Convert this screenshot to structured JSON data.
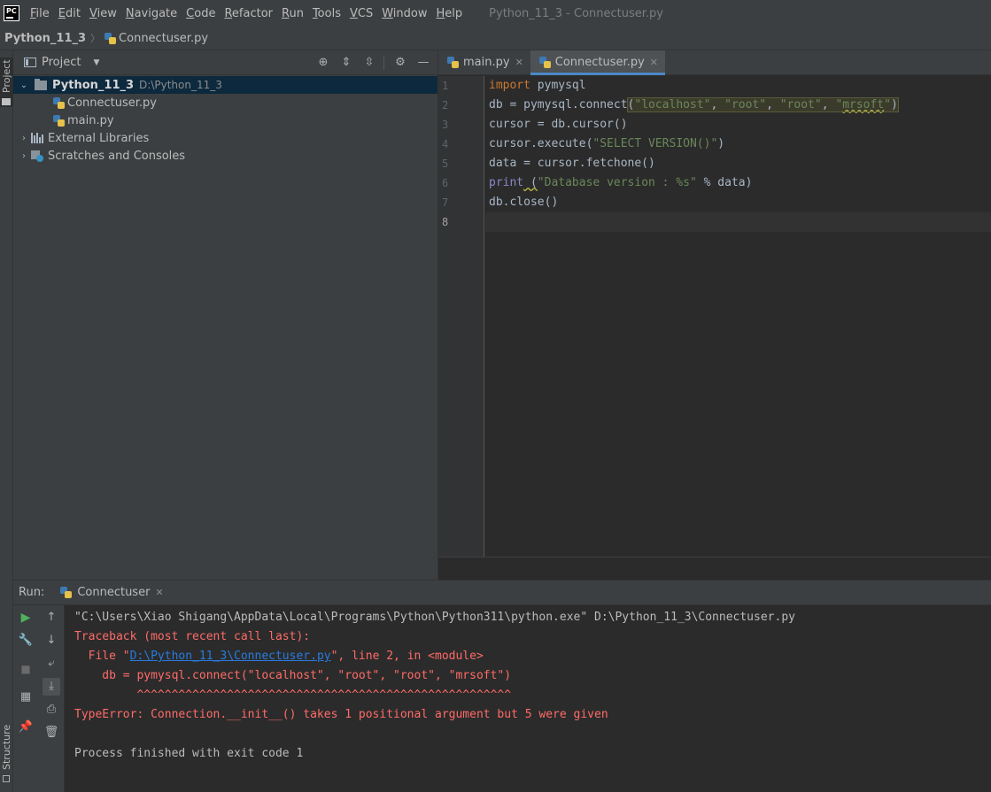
{
  "menu": {
    "logo": "PC",
    "items": [
      {
        "first": "F",
        "rest": "ile"
      },
      {
        "first": "E",
        "rest": "dit"
      },
      {
        "first": "V",
        "rest": "iew"
      },
      {
        "first": "N",
        "rest": "avigate"
      },
      {
        "first": "C",
        "rest": "ode"
      },
      {
        "first": "R",
        "rest": "efactor"
      },
      {
        "first": "R",
        "rest": "un"
      },
      {
        "first": "T",
        "rest": "ools"
      },
      {
        "first": "V",
        "rest": "CS"
      },
      {
        "first": "W",
        "rest": "indow"
      },
      {
        "first": "H",
        "rest": "elp"
      }
    ],
    "window_title": "Python_11_3 - Connectuser.py"
  },
  "navbar": {
    "project": "Python_11_3",
    "separator": "〉",
    "file": "Connectuser.py"
  },
  "side_strip": {
    "project_label": "Project",
    "structure_label": "Structure"
  },
  "project_panel": {
    "title": "Project",
    "tree": {
      "root_name": "Python_11_3",
      "root_path": "D:\\Python_11_3",
      "files": [
        "Connectuser.py",
        "main.py"
      ],
      "external_libraries": "External Libraries",
      "scratches": "Scratches and Consoles"
    }
  },
  "editor": {
    "tabs": [
      {
        "label": "main.py"
      },
      {
        "label": "Connectuser.py"
      }
    ],
    "line_numbers": [
      "1",
      "2",
      "3",
      "4",
      "5",
      "6",
      "7",
      "8"
    ],
    "code": {
      "l1_kw": "import",
      "l1_rest": " pymysql",
      "l2_pre": "db = pymysql.connect",
      "l2_open": "(",
      "l2_s1": "\"localhost\"",
      "l2_c1": ", ",
      "l2_s2": "\"root\"",
      "l2_c2": ", ",
      "l2_s3": "\"root\"",
      "l2_c3": ", ",
      "l2_s4a": "\"",
      "l2_s4b": "mrsoft",
      "l2_s4c": "\"",
      "l2_close": ")",
      "l3": "cursor = db.cursor()",
      "l4_pre": "cursor.execute(",
      "l4_str": "\"SELECT VERSION()\"",
      "l4_post": ")",
      "l5": "data = cursor.fetchone()",
      "l6_fn": "print",
      "l6_sp": " (",
      "l6_str": "\"Database version : %s\"",
      "l6_post": " % data)",
      "l7": "db.close()",
      "l8": ""
    }
  },
  "run_panel": {
    "label": "Run:",
    "tab": "Connectuser",
    "console": {
      "cmd": "\"C:\\Users\\Xiao Shigang\\AppData\\Local\\Programs\\Python\\Python311\\python.exe\" D:\\Python_11_3\\Connectuser.py",
      "traceback": "Traceback (most recent call last):",
      "file_pre": "  File \"",
      "file_link": "D:\\Python_11_3\\Connectuser.py",
      "file_post": "\", line 2, in <module>",
      "code_line": "    db = pymysql.connect(\"localhost\", \"root\", \"root\", \"mrsoft\")",
      "carets": "         ^^^^^^^^^^^^^^^^^^^^^^^^^^^^^^^^^^^^^^^^^^^^^^^^^^^^^^",
      "error": "TypeError: Connection.__init__() takes 1 positional argument but 5 were given",
      "blank": "",
      "exit": "Process finished with exit code 1"
    }
  },
  "colors": {
    "background": "#2b2b2b",
    "panel": "#3c3f41",
    "keyword": "#cc7832",
    "string": "#6a8759",
    "error": "#ff6b68",
    "link": "#287bde",
    "selection": "#0d293e"
  }
}
